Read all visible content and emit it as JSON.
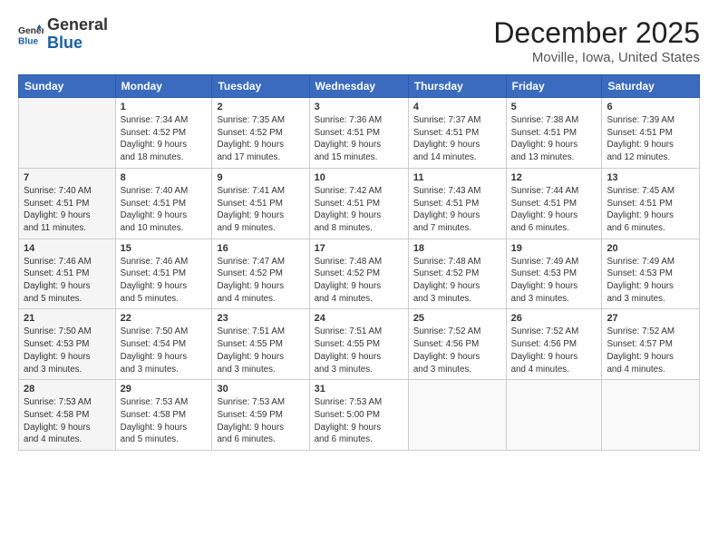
{
  "header": {
    "logo_general": "General",
    "logo_blue": "Blue",
    "month": "December 2025",
    "location": "Moville, Iowa, United States"
  },
  "weekdays": [
    "Sunday",
    "Monday",
    "Tuesday",
    "Wednesday",
    "Thursday",
    "Friday",
    "Saturday"
  ],
  "weeks": [
    [
      {
        "day": "",
        "info": ""
      },
      {
        "day": "1",
        "info": "Sunrise: 7:34 AM\nSunset: 4:52 PM\nDaylight: 9 hours\nand 18 minutes."
      },
      {
        "day": "2",
        "info": "Sunrise: 7:35 AM\nSunset: 4:52 PM\nDaylight: 9 hours\nand 17 minutes."
      },
      {
        "day": "3",
        "info": "Sunrise: 7:36 AM\nSunset: 4:51 PM\nDaylight: 9 hours\nand 15 minutes."
      },
      {
        "day": "4",
        "info": "Sunrise: 7:37 AM\nSunset: 4:51 PM\nDaylight: 9 hours\nand 14 minutes."
      },
      {
        "day": "5",
        "info": "Sunrise: 7:38 AM\nSunset: 4:51 PM\nDaylight: 9 hours\nand 13 minutes."
      },
      {
        "day": "6",
        "info": "Sunrise: 7:39 AM\nSunset: 4:51 PM\nDaylight: 9 hours\nand 12 minutes."
      }
    ],
    [
      {
        "day": "7",
        "info": "Sunrise: 7:40 AM\nSunset: 4:51 PM\nDaylight: 9 hours\nand 11 minutes."
      },
      {
        "day": "8",
        "info": "Sunrise: 7:40 AM\nSunset: 4:51 PM\nDaylight: 9 hours\nand 10 minutes."
      },
      {
        "day": "9",
        "info": "Sunrise: 7:41 AM\nSunset: 4:51 PM\nDaylight: 9 hours\nand 9 minutes."
      },
      {
        "day": "10",
        "info": "Sunrise: 7:42 AM\nSunset: 4:51 PM\nDaylight: 9 hours\nand 8 minutes."
      },
      {
        "day": "11",
        "info": "Sunrise: 7:43 AM\nSunset: 4:51 PM\nDaylight: 9 hours\nand 7 minutes."
      },
      {
        "day": "12",
        "info": "Sunrise: 7:44 AM\nSunset: 4:51 PM\nDaylight: 9 hours\nand 6 minutes."
      },
      {
        "day": "13",
        "info": "Sunrise: 7:45 AM\nSunset: 4:51 PM\nDaylight: 9 hours\nand 6 minutes."
      }
    ],
    [
      {
        "day": "14",
        "info": "Sunrise: 7:46 AM\nSunset: 4:51 PM\nDaylight: 9 hours\nand 5 minutes."
      },
      {
        "day": "15",
        "info": "Sunrise: 7:46 AM\nSunset: 4:51 PM\nDaylight: 9 hours\nand 5 minutes."
      },
      {
        "day": "16",
        "info": "Sunrise: 7:47 AM\nSunset: 4:52 PM\nDaylight: 9 hours\nand 4 minutes."
      },
      {
        "day": "17",
        "info": "Sunrise: 7:48 AM\nSunset: 4:52 PM\nDaylight: 9 hours\nand 4 minutes."
      },
      {
        "day": "18",
        "info": "Sunrise: 7:48 AM\nSunset: 4:52 PM\nDaylight: 9 hours\nand 3 minutes."
      },
      {
        "day": "19",
        "info": "Sunrise: 7:49 AM\nSunset: 4:53 PM\nDaylight: 9 hours\nand 3 minutes."
      },
      {
        "day": "20",
        "info": "Sunrise: 7:49 AM\nSunset: 4:53 PM\nDaylight: 9 hours\nand 3 minutes."
      }
    ],
    [
      {
        "day": "21",
        "info": "Sunrise: 7:50 AM\nSunset: 4:53 PM\nDaylight: 9 hours\nand 3 minutes."
      },
      {
        "day": "22",
        "info": "Sunrise: 7:50 AM\nSunset: 4:54 PM\nDaylight: 9 hours\nand 3 minutes."
      },
      {
        "day": "23",
        "info": "Sunrise: 7:51 AM\nSunset: 4:55 PM\nDaylight: 9 hours\nand 3 minutes."
      },
      {
        "day": "24",
        "info": "Sunrise: 7:51 AM\nSunset: 4:55 PM\nDaylight: 9 hours\nand 3 minutes."
      },
      {
        "day": "25",
        "info": "Sunrise: 7:52 AM\nSunset: 4:56 PM\nDaylight: 9 hours\nand 3 minutes."
      },
      {
        "day": "26",
        "info": "Sunrise: 7:52 AM\nSunset: 4:56 PM\nDaylight: 9 hours\nand 4 minutes."
      },
      {
        "day": "27",
        "info": "Sunrise: 7:52 AM\nSunset: 4:57 PM\nDaylight: 9 hours\nand 4 minutes."
      }
    ],
    [
      {
        "day": "28",
        "info": "Sunrise: 7:53 AM\nSunset: 4:58 PM\nDaylight: 9 hours\nand 4 minutes."
      },
      {
        "day": "29",
        "info": "Sunrise: 7:53 AM\nSunset: 4:58 PM\nDaylight: 9 hours\nand 5 minutes."
      },
      {
        "day": "30",
        "info": "Sunrise: 7:53 AM\nSunset: 4:59 PM\nDaylight: 9 hours\nand 6 minutes."
      },
      {
        "day": "31",
        "info": "Sunrise: 7:53 AM\nSunset: 5:00 PM\nDaylight: 9 hours\nand 6 minutes."
      },
      {
        "day": "",
        "info": ""
      },
      {
        "day": "",
        "info": ""
      },
      {
        "day": "",
        "info": ""
      }
    ]
  ]
}
